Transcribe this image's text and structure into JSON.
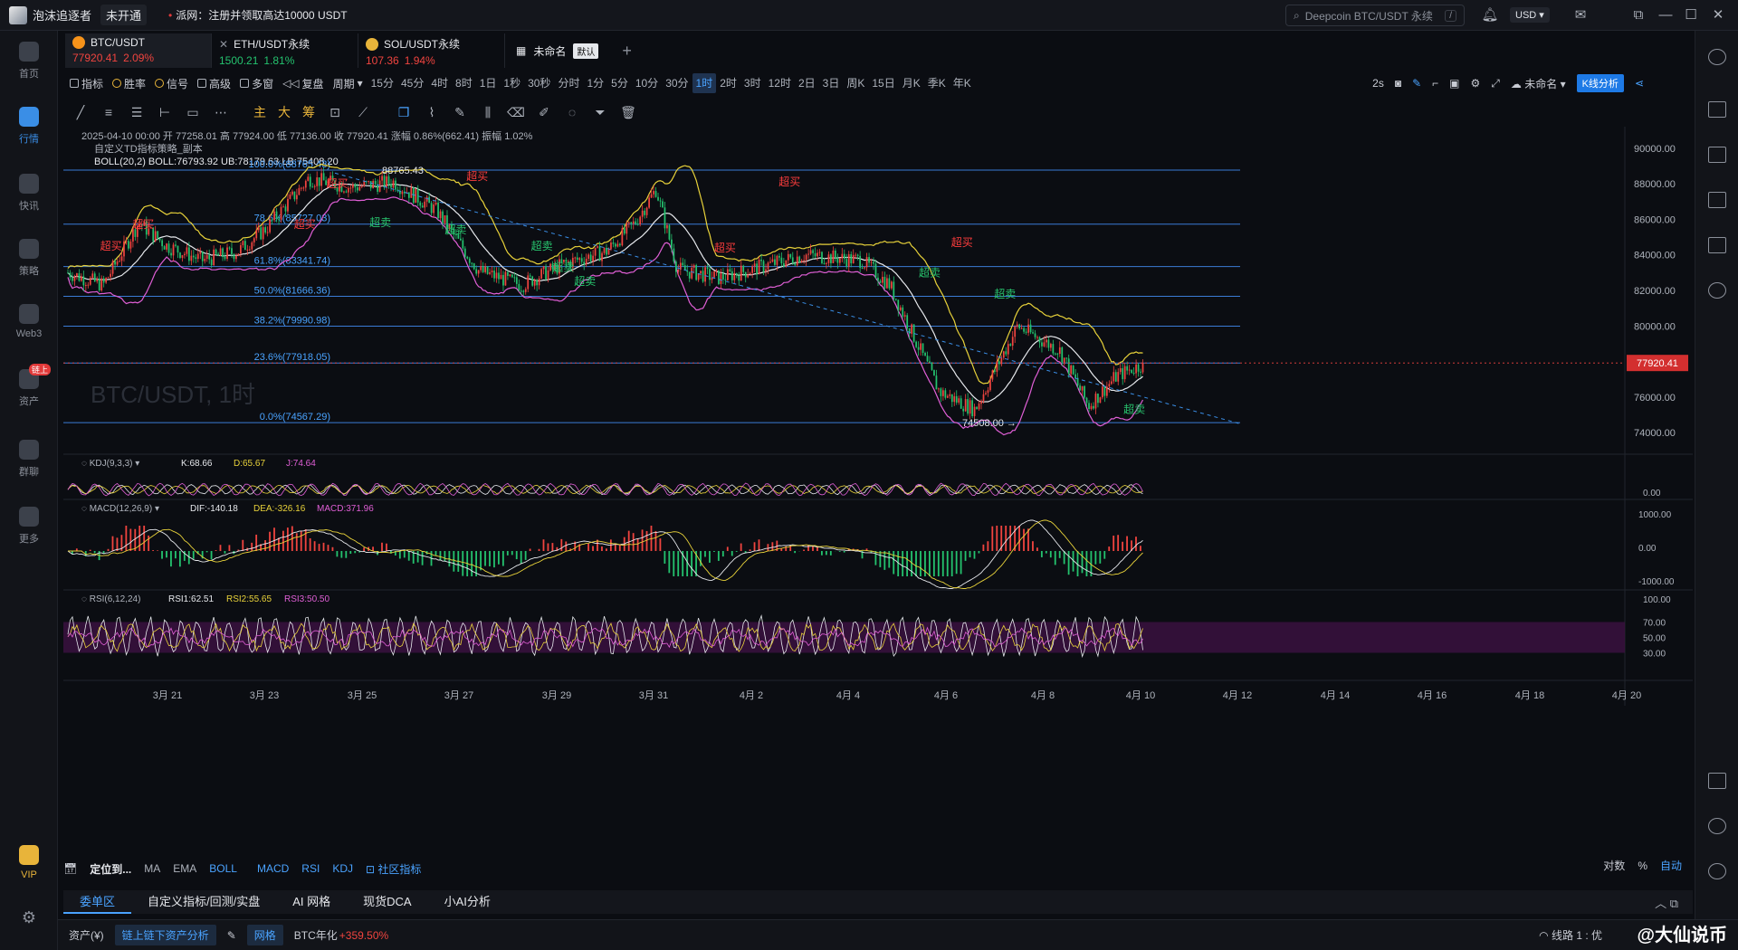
{
  "titlebar": {
    "app_name": "泡沫追逐者",
    "status_badge": "未开通",
    "notice": "派网：注册并领取高达10000 USDT",
    "search_placeholder": "Deepcoin BTC/USDT 永续",
    "search_shortcut": "/",
    "currency": "USD"
  },
  "leftnav": [
    {
      "label": "首页",
      "icon": "home-icon"
    },
    {
      "label": "行情",
      "icon": "market-icon",
      "active": true
    },
    {
      "label": "快讯",
      "icon": "news-icon"
    },
    {
      "label": "策略",
      "icon": "strategy-icon"
    },
    {
      "label": "Web3",
      "icon": "web3-icon"
    },
    {
      "label": "资产",
      "icon": "asset-icon",
      "badge": "链上"
    },
    {
      "label": "群聊",
      "icon": "chat-icon"
    },
    {
      "label": "更多",
      "icon": "more-icon"
    },
    {
      "label": "VIP",
      "icon": "vip-icon"
    }
  ],
  "symbol_tabs": [
    {
      "name": "BTC/USDT",
      "price": "77920.41",
      "change": "2.09%",
      "color": "#f0443f",
      "coin_color": "#f7931a"
    },
    {
      "name": "ETH/USDT永续",
      "price": "1500.21",
      "change": "1.81%",
      "color": "#24c26e",
      "coin_color": "#e6e8ec"
    },
    {
      "name": "SOL/USDT永续",
      "price": "107.36",
      "change": "1.94%",
      "color": "#f0443f",
      "coin_color": "#e8b43a"
    }
  ],
  "workspace_tab": {
    "name": "未命名",
    "default_label": "默认"
  },
  "toolbar": {
    "indicator": "指标",
    "win_rate": "胜率",
    "signal": "信号",
    "advanced": "高级",
    "multi": "多窗",
    "replay": "复盘",
    "period": "周期",
    "timeframes": [
      "15分",
      "45分",
      "4时",
      "8时",
      "1日",
      "1秒",
      "30秒",
      "分时",
      "1分",
      "5分",
      "10分",
      "30分",
      "1时",
      "2时",
      "3时",
      "12时",
      "2日",
      "3日",
      "周K",
      "15日",
      "月K",
      "季K",
      "年K"
    ],
    "active_timeframe": "1时",
    "refresh": "2s",
    "layout_name": "未命名",
    "kline_analysis": "K线分析"
  },
  "drawing_tools": {
    "cn_tools": [
      "主",
      "大",
      "筹"
    ]
  },
  "chart_header": {
    "ohlc_line": "2025-04-10 00:00  开 77258.01  高 77924.00  低 77136.00  收 77920.41  涨幅 0.86%(662.41)  振幅 1.02%",
    "strategy_label": "自定义TD指标策略_副本",
    "boll_label": "BOLL(20,2)",
    "boll_values": "BOLL:76793.92  UB:78179.63  LB:75408.20",
    "watermark": "BTC/USDT, 1时",
    "last_price": "77920.41",
    "high_label": "88765.43",
    "low_label": "74508.00"
  },
  "chart_data": {
    "type": "candlestick",
    "symbol": "BTC/USDT",
    "interval": "1时",
    "price_axis": [
      "90000.00",
      "88000.00",
      "86000.00",
      "84000.00",
      "82000.00",
      "80000.00",
      "78000.00",
      "76000.00",
      "74000.00"
    ],
    "ylim": [
      73300,
      90700
    ],
    "date_axis": [
      "3月 21",
      "3月 23",
      "3月 25",
      "3月 27",
      "3月 29",
      "3月 31",
      "4月 2",
      "4月 4",
      "4月 6",
      "4月 8",
      "4月 10",
      "4月 12",
      "4月 14",
      "4月 16",
      "4月 18",
      "4月 20"
    ],
    "fibonacci": [
      {
        "label": "100.0%(88765.43)",
        "price": 88765.43
      },
      {
        "label": "78.6%(85727.03)",
        "price": 85727.03
      },
      {
        "label": "61.8%(83341.74)",
        "price": 83341.74
      },
      {
        "label": "50.0%(81666.36)",
        "price": 81666.36
      },
      {
        "label": "38.2%(79990.98)",
        "price": 79990.98
      },
      {
        "label": "23.6%(77918.05)",
        "price": 77918.05
      },
      {
        "label": "0.0%(74567.29)",
        "price": 74567.29
      }
    ],
    "signals": [
      {
        "text": "超买",
        "t": 0.04,
        "price": 84300,
        "kind": "buy"
      },
      {
        "text": "超买",
        "t": 0.07,
        "price": 85500,
        "kind": "buy"
      },
      {
        "text": "超买",
        "t": 0.22,
        "price": 85500,
        "kind": "buy"
      },
      {
        "text": "超买",
        "t": 0.25,
        "price": 87800,
        "kind": "buy"
      },
      {
        "text": "超买",
        "t": 0.38,
        "price": 88200,
        "kind": "buy"
      },
      {
        "text": "超卖",
        "t": 0.29,
        "price": 85600,
        "kind": "sell"
      },
      {
        "text": "超卖",
        "t": 0.36,
        "price": 85200,
        "kind": "sell"
      },
      {
        "text": "超卖",
        "t": 0.44,
        "price": 84300,
        "kind": "sell"
      },
      {
        "text": "超卖",
        "t": 0.46,
        "price": 83100,
        "kind": "sell"
      },
      {
        "text": "超卖",
        "t": 0.48,
        "price": 82300,
        "kind": "sell"
      },
      {
        "text": "超买",
        "t": 0.61,
        "price": 84200,
        "kind": "buy"
      },
      {
        "text": "超买",
        "t": 0.67,
        "price": 87900,
        "kind": "buy"
      },
      {
        "text": "超卖",
        "t": 0.8,
        "price": 82800,
        "kind": "sell"
      },
      {
        "text": "超买",
        "t": 0.83,
        "price": 84500,
        "kind": "buy"
      },
      {
        "text": "超卖",
        "t": 0.87,
        "price": 81600,
        "kind": "sell"
      },
      {
        "text": "超卖",
        "t": 0.99,
        "price": 75100,
        "kind": "sell"
      }
    ],
    "kdj": {
      "label": "KDJ(9,3,3)",
      "k": "K:68.66",
      "d": "D:65.67",
      "j": "J:74.64",
      "axis": [
        "0.00"
      ]
    },
    "macd": {
      "label": "MACD(12,26,9)",
      "dif": "DIF:-140.18",
      "dea": "DEA:-326.16",
      "macd": "MACD:371.96",
      "axis": [
        "1000.00",
        "0.00",
        "-1000.00"
      ]
    },
    "rsi": {
      "label": "RSI(6,12,24)",
      "rsi1": "RSI1:62.51",
      "rsi2": "RSI2:55.65",
      "rsi3": "RSI3:50.50",
      "axis": [
        "100.00",
        "70.00",
        "50.00",
        "30.00"
      ]
    },
    "colors": {
      "up": "#f0443f",
      "down": "#24c26e",
      "ub": "#e8d23a",
      "mid": "#e6e8ec",
      "lb": "#e05fd6",
      "fib": "#3a7bd5",
      "trend": "#3a8ee6"
    }
  },
  "bottom_bar": {
    "locate": "定位到...",
    "indicators": [
      "MA",
      "EMA",
      "BOLL",
      "MACD",
      "RSI",
      "KDJ"
    ],
    "community": "社区指标",
    "log_label": "对数",
    "pct_label": "%",
    "auto_label": "自动"
  },
  "panel_tabs": [
    "委单区",
    "自定义指标/回测/实盘",
    "AI 网格",
    "现货DCA",
    "小AI分析"
  ],
  "status_bar": {
    "asset_label": "资产(¥)",
    "chain_button": "链上链下资产分析",
    "net_label": "网格",
    "btc_annual": "BTC年化",
    "btc_annual_value": "+359.50%",
    "line_label": "线路 1 : 优",
    "watermark": "@大仙说币"
  }
}
